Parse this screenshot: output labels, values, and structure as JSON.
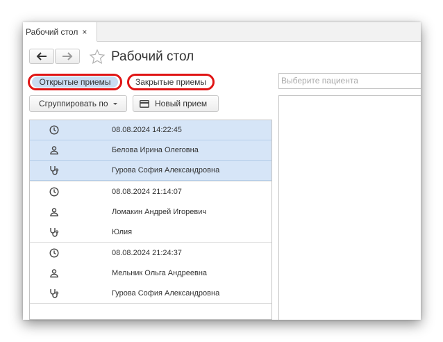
{
  "tab": {
    "label": "Рабочий стол",
    "close_symbol": "×"
  },
  "nav": {
    "back_icon": "arrow-left-icon",
    "forward_icon": "arrow-right-icon",
    "favorite_icon": "star-icon"
  },
  "page": {
    "title": "Рабочий стол"
  },
  "filters": {
    "open_label": "Открытые приемы",
    "closed_label": "Закрытые приемы"
  },
  "toolbar": {
    "group_by_label": "Сгруппировать по",
    "new_appointment_label": "Новый прием"
  },
  "patient_search": {
    "placeholder": "Выберите пациента"
  },
  "appointments": [
    {
      "datetime": "08.08.2024 14:22:45",
      "patient": "Белова Ирина Олеговна",
      "doctor": "Гурова София Александровна",
      "selected": true
    },
    {
      "datetime": "08.08.2024 21:14:07",
      "patient": "Ломакин Андрей Игоревич",
      "doctor": "Юлия",
      "selected": false
    },
    {
      "datetime": "08.08.2024 21:24:37",
      "patient": "Мельник Ольга Андреевна",
      "doctor": "Гурова София Александровна",
      "selected": false
    }
  ],
  "colors": {
    "highlight": "#e01515",
    "selection": "#d6e5f7",
    "accent": "#c9dcf2"
  }
}
